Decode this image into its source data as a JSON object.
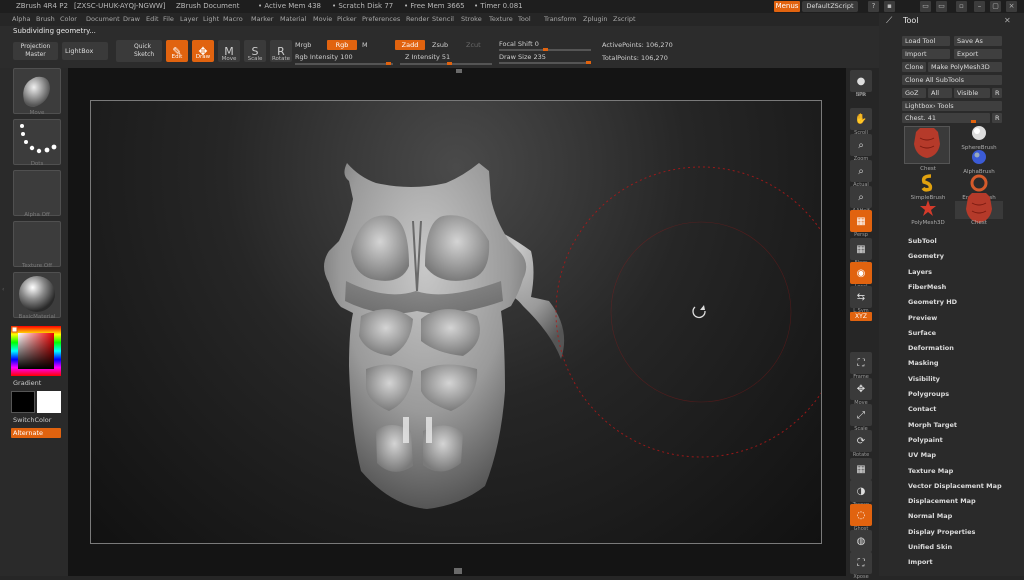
{
  "titlebar": {
    "app": "ZBrush 4R4 P2",
    "serial": "[ZXSC-UHUK-AYQJ-NGWW]",
    "document": "ZBrush Document",
    "active_mem": "• Active Mem 438",
    "scratch_disk": "• Scratch Disk 77",
    "free_mem": "• Free Mem 3665",
    "timer": "• Timer 0.081",
    "menus_label": "Menus",
    "script_label": "DefaultZScript"
  },
  "menubar": [
    "Alpha",
    "Brush",
    "Color",
    "Document",
    "Draw",
    "Edit",
    "File",
    "Layer",
    "Light",
    "Macro",
    "Marker",
    "Material",
    "Movie",
    "Picker",
    "Preferences",
    "Render",
    "Stencil",
    "Stroke",
    "Texture",
    "Tool",
    "Transform",
    "Zplugin",
    "Zscript"
  ],
  "status": "Subdividing geometry...",
  "toolbar": {
    "projection_master": "Projection Master",
    "lightbox": "LightBox",
    "quick_sketch": "Quick Sketch",
    "edit": "Edit",
    "draw": "Draw",
    "move": "Move",
    "scale": "Scale",
    "rotate": "Rotate",
    "mrgb": "Mrgb",
    "rgb": "Rgb",
    "m": "M",
    "rgb_intensity": "Rgb Intensity 100",
    "zadd": "Zadd",
    "zsub": "Zsub",
    "zcut": "Zcut",
    "z_intensity": "Z Intensity 51",
    "focal_shift": "Focal Shift 0",
    "draw_size": "Draw Size 235",
    "active_points": "ActivePoints: 106,270",
    "total_points": "TotalPoints: 106,270"
  },
  "leftpanel": {
    "brush": "Move",
    "stroke": "Dots",
    "alpha": "Alpha Off",
    "texture": "Texture Off",
    "material": "BasicMaterial",
    "gradient": "Gradient",
    "switchcolor": "SwitchColor",
    "alternate": "Alternate"
  },
  "rightstrip": [
    "BPR",
    "SPix",
    "Scroll",
    "Zoom",
    "Actual",
    "AAHalf",
    "Persp",
    "Floor",
    "Local",
    "L.Sym",
    "XYZ",
    "Frame",
    "Move",
    "Scale",
    "Rotate",
    "PolyF",
    "Transp",
    "Ghost",
    "Solo",
    "Xpose"
  ],
  "toolpanel": {
    "title": "Tool",
    "load_tool": "Load Tool",
    "save_as": "Save As",
    "import": "Import",
    "export": "Export",
    "clone": "Clone",
    "make_polymesh": "Make PolyMesh3D",
    "clone_all": "Clone All SubTools",
    "goz": "GoZ",
    "all": "All",
    "visible": "Visible",
    "r": "R",
    "lightbox_tools": "Lightbox› Tools",
    "chest_slider": "Chest. 41",
    "tools": [
      {
        "name": "Chest",
        "icon": "chest"
      },
      {
        "name": "SphereBrush",
        "icon": "sphere"
      },
      {
        "name": "AlphaBrush",
        "icon": "alpha"
      },
      {
        "name": "SimpleBrush",
        "icon": "simple"
      },
      {
        "name": "EraserBrush",
        "icon": "eraser"
      },
      {
        "name": "PolyMesh3D",
        "icon": "star"
      },
      {
        "name": "Chest",
        "icon": "chest"
      }
    ],
    "menus": [
      "SubTool",
      "Geometry",
      "Layers",
      "FiberMesh",
      "Geometry HD",
      "Preview",
      "Surface",
      "Deformation",
      "Masking",
      "Visibility",
      "Polygroups",
      "Contact",
      "Morph Target",
      "Polypaint",
      "UV Map",
      "Texture Map",
      "Vector Displacement Map",
      "Displacement Map",
      "Normal Map",
      "Display Properties",
      "Unified Skin",
      "Import"
    ]
  },
  "colors": {
    "accent": "#e1630f",
    "panel": "#2a2a2a"
  }
}
